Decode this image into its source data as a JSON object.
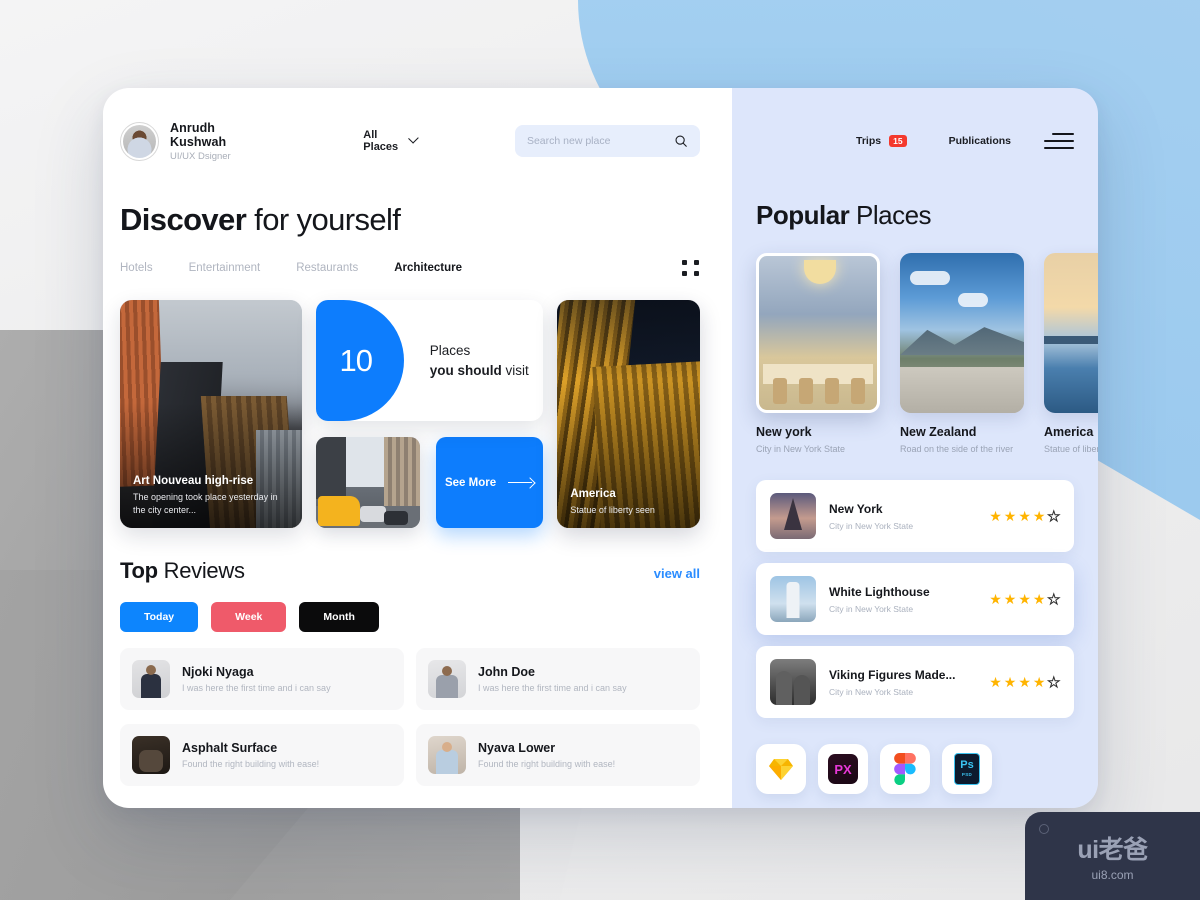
{
  "header": {
    "user_name": "Anrudh Kushwah",
    "user_role": "UI/UX Dsigner",
    "places_filter": "All Places",
    "search_placeholder": "Search new place",
    "search_value": ""
  },
  "main": {
    "headline_bold": "Discover",
    "headline_rest": " for yourself",
    "tabs": [
      {
        "label": "Hotels",
        "active": false
      },
      {
        "label": "Entertainment",
        "active": false
      },
      {
        "label": "Restaurants",
        "active": false
      },
      {
        "label": "Architecture",
        "active": true
      }
    ],
    "feature_card": {
      "title": "Art Nouveau high-rise",
      "subtitle": "The opening took place yesterday in the city center..."
    },
    "promo": {
      "number": "10",
      "line1": "Places",
      "line2_bold": "you should",
      "line2_rest": " visit"
    },
    "see_more_label": "See More",
    "night_card": {
      "title": "America",
      "subtitle": "Statue of liberty seen"
    }
  },
  "reviews": {
    "title_bold": "Top",
    "title_rest": " Reviews",
    "view_all": "view all",
    "filters": [
      {
        "label": "Today",
        "color": "#0d85fd"
      },
      {
        "label": "Week",
        "color": "#ef5a6a"
      },
      {
        "label": "Month",
        "color": "#0b0b0c"
      }
    ],
    "items": [
      {
        "name": "Njoki Nyaga",
        "text": "I was here the first time and i can say"
      },
      {
        "name": "John Doe",
        "text": "I was here the first time and i can say"
      },
      {
        "name": "Asphalt Surface",
        "text": "Found the right building with ease!"
      },
      {
        "name": "Nyava Lower",
        "text": "Found the right building with ease!"
      }
    ]
  },
  "sidebar": {
    "nav_trips": "Trips",
    "trips_badge": "15",
    "nav_publications": "Publications",
    "title_bold": "Popular",
    "title_rest": " Places",
    "places": [
      {
        "name": "New york",
        "sub": "City in New York State",
        "selected": true
      },
      {
        "name": "New Zealand",
        "sub": "Road on the side of the river",
        "selected": false
      },
      {
        "name": "America",
        "sub": "Statue of liberty",
        "selected": false
      }
    ],
    "list": [
      {
        "name": "New York",
        "sub": "City in New York State",
        "rating": 4,
        "max": 5,
        "highlight": false
      },
      {
        "name": "White Lighthouse",
        "sub": "City in New York State",
        "rating": 4,
        "max": 5,
        "highlight": true
      },
      {
        "name": "Viking Figures Made...",
        "sub": "City in New York State",
        "rating": 4,
        "max": 5,
        "highlight": false
      }
    ],
    "apps": [
      {
        "name": "sketch",
        "label": ""
      },
      {
        "name": "pixelmator",
        "label": "PX"
      },
      {
        "name": "figma",
        "label": ""
      },
      {
        "name": "photoshop",
        "label": "Ps",
        "sub": "PSD"
      }
    ]
  },
  "watermark": {
    "main": "ui老爸",
    "sub": "ui8.com"
  },
  "colors": {
    "accent_blue": "#0d7dfd",
    "badge_red": "#f4392d",
    "pink": "#ef5a6a",
    "panel_blue": "#dde6fb",
    "star_gold": "#ffb400"
  }
}
